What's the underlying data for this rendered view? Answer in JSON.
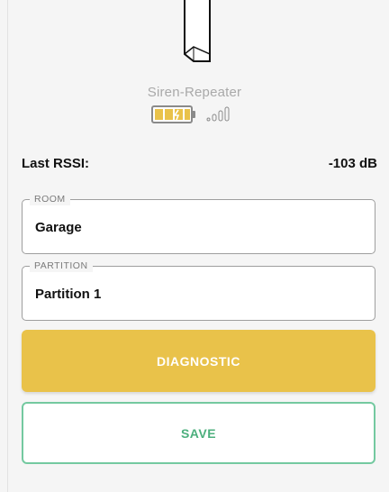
{
  "device": {
    "name": "Siren-Repeater",
    "battery_icon": "battery-icon",
    "signal_icon": "signal-strength-icon",
    "battery_color": "#e9c24a",
    "battery_level": 1.0
  },
  "rssi": {
    "label": "Last RSSI:",
    "value": "-103 dB"
  },
  "fields": {
    "room": {
      "legend": "ROOM",
      "value": "Garage"
    },
    "partition": {
      "legend": "PARTITION",
      "value": "Partition 1"
    }
  },
  "buttons": {
    "diagnostic_label": "DIAGNOSTIC",
    "save_label": "SAVE"
  },
  "colors": {
    "accent": "#e9c24a",
    "save_text": "#4caf7d",
    "save_border": "#74c9a0"
  }
}
